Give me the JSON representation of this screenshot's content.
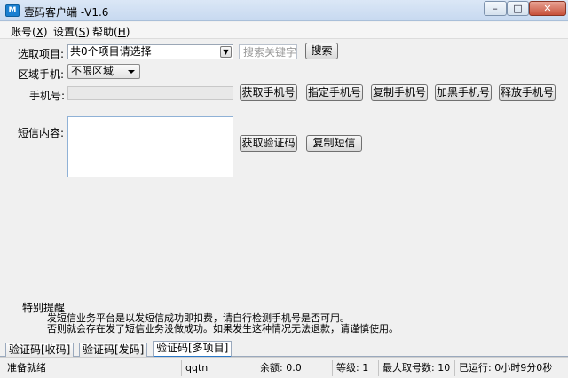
{
  "window": {
    "title": "壹码客户端 -V1.6",
    "icon_label": "M",
    "minimize_glyph": "–",
    "maximize_glyph": "□",
    "close_glyph": "✕"
  },
  "menu": {
    "items": [
      {
        "label": "账号(",
        "key": "X",
        "suffix": ")"
      },
      {
        "label": "设置(",
        "key": "S",
        "suffix": ")"
      },
      {
        "label": "帮助(",
        "key": "H",
        "suffix": ")"
      }
    ]
  },
  "form": {
    "project_label": "选取项目:",
    "project_value": "共0个项目请选择",
    "search_placeholder": "搜索关键字",
    "search_button": "搜索",
    "region_label": "区域手机:",
    "region_value": "不限区域",
    "phone_label": "手机号:",
    "phone_value": "",
    "get_phone_button": "获取手机号",
    "specify_phone_button": "指定手机号",
    "copy_phone_button": "复制手机号",
    "blacklist_phone_button": "加黑手机号",
    "release_phone_button": "释放手机号",
    "sms_label": "短信内容:",
    "sms_value": "",
    "get_code_button": "获取验证码",
    "copy_sms_button": "复制短信"
  },
  "notice": {
    "title": "特别提醒",
    "line1": "发短信业务平台是以发短信成功即扣费，请自行检测手机号是否可用。",
    "line2": "否则就会存在发了短信业务没做成功。如果发生这种情况无法退款，请谨慎使用。"
  },
  "tabs": [
    {
      "label": "验证码[收码]",
      "active": false
    },
    {
      "label": "验证码[发码]",
      "active": false
    },
    {
      "label": "验证码[多项目]",
      "active": true
    }
  ],
  "status": {
    "state": "准备就绪",
    "user": "qqtn",
    "balance": "余额: 0.0",
    "level": "等级: 1",
    "max_fetch": "最大取号数: 10",
    "running": "已运行: 0小时9分0秒"
  }
}
